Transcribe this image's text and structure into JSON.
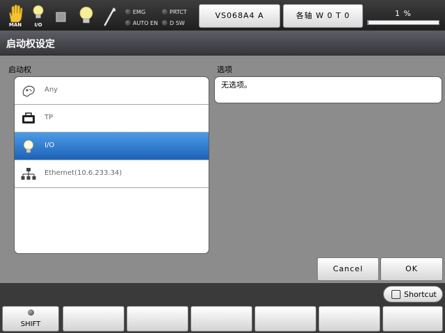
{
  "status": {
    "mode_icons": [
      {
        "icon": "hand-icon",
        "label": "MAN"
      },
      {
        "icon": "bulb-icon",
        "label": "I/O"
      },
      {
        "icon": "stop-square-icon",
        "label": ""
      },
      {
        "icon": "bulb-icon",
        "label": ""
      },
      {
        "icon": "wrench-icon",
        "label": ""
      }
    ],
    "indicators": [
      "EMG",
      "PRTCT",
      "AUTO EN",
      "D SW"
    ],
    "robot_button": "VS068A4 A",
    "axis_button": "各轴 W 0 T 0",
    "speed_text": "1 %",
    "speed_value": 1
  },
  "title": "启动权设定",
  "left_label": "启动权",
  "list_items": [
    {
      "label": "Any",
      "icon": "any-hand-icon",
      "selected": false
    },
    {
      "label": "TP",
      "icon": "teach-pendant-icon",
      "selected": false
    },
    {
      "label": "I/O",
      "icon": "bulb-icon",
      "selected": true
    },
    {
      "label": "Ethernet(10.6.233.34)",
      "icon": "network-icon",
      "selected": false
    }
  ],
  "options_label": "选项",
  "options_text": "无选项。",
  "buttons": {
    "cancel": "Cancel",
    "ok": "OK"
  },
  "shortcut": "Shortcut",
  "fkeys": [
    "SHIFT",
    "",
    "",
    "",
    "",
    "",
    ""
  ],
  "colors": {
    "selected": "#2a78d0",
    "background": "#8c8c8c"
  }
}
